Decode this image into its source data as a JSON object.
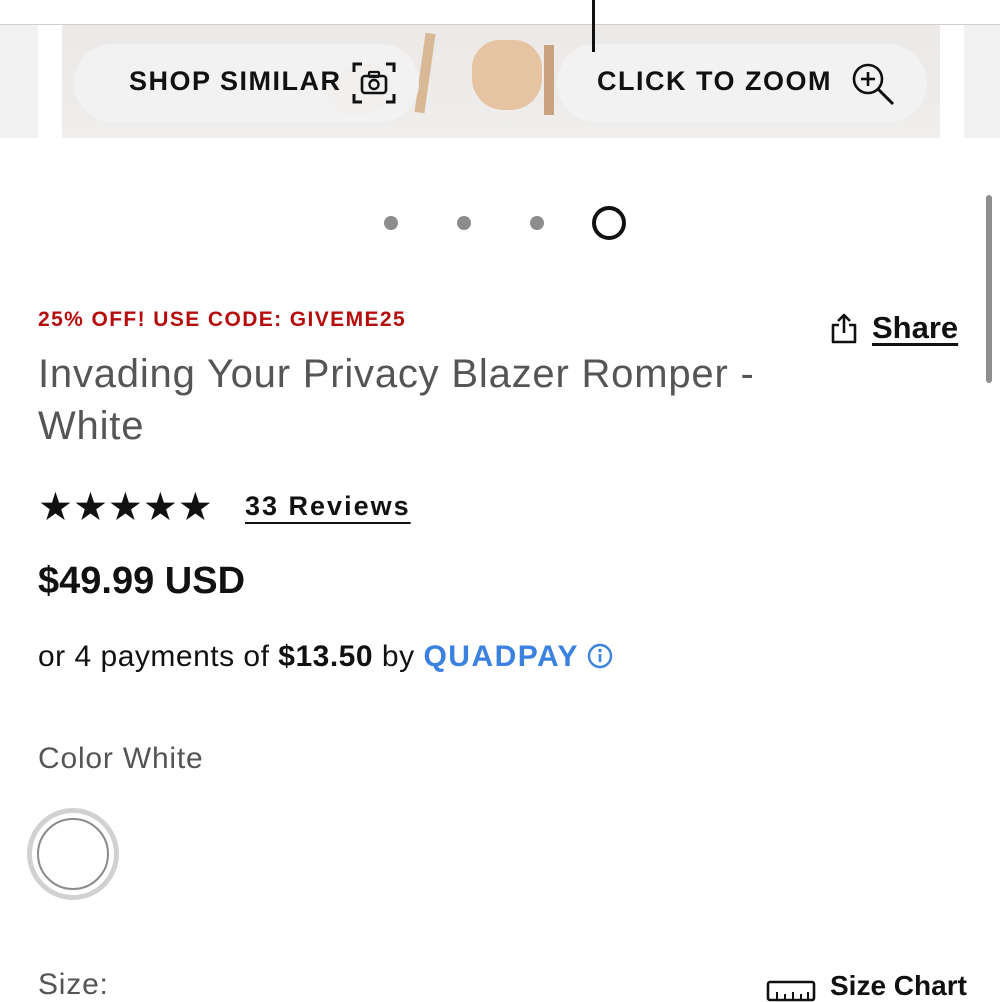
{
  "carousel": {
    "shop_similar_label": "SHOP SIMILAR",
    "click_to_zoom_label": "CLICK TO ZOOM",
    "shop_similar_icon": "camera-scan-icon",
    "zoom_icon": "zoom-in-icon",
    "slide_count": 4,
    "active_slide": 4
  },
  "promo": {
    "text": "25% OFF! USE CODE: GIVEME25",
    "color": "#b50d0d"
  },
  "share": {
    "label": "Share",
    "icon": "share-icon"
  },
  "product": {
    "title": "Invading Your Privacy Blazer Romper - White",
    "rating": 5,
    "reviews_label": "33 Reviews",
    "price": "$49.99 USD"
  },
  "installments": {
    "prefix": "or 4 payments of",
    "amount": "$13.50",
    "by": "by",
    "brand": "QUADPAY",
    "brand_color": "#3b82e0",
    "info_icon": "info-circle-icon"
  },
  "color": {
    "label": "Color White",
    "selected_swatch": "white"
  },
  "size": {
    "label": "Size:",
    "chart_label": "Size Chart",
    "chart_icon": "ruler-icon"
  }
}
